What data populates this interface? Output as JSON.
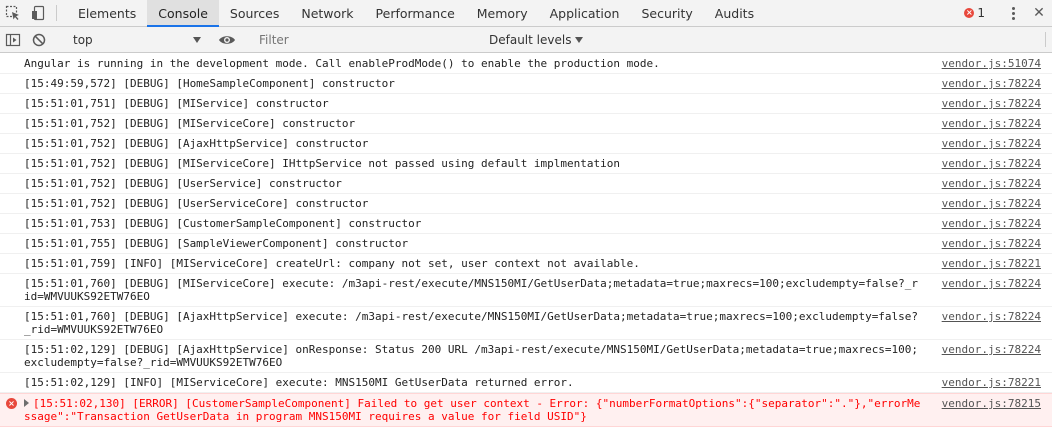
{
  "tabbar": {
    "tabs": [
      {
        "label": "Elements"
      },
      {
        "label": "Console"
      },
      {
        "label": "Sources"
      },
      {
        "label": "Network"
      },
      {
        "label": "Performance"
      },
      {
        "label": "Memory"
      },
      {
        "label": "Application"
      },
      {
        "label": "Security"
      },
      {
        "label": "Audits"
      }
    ],
    "selected_tab": "Console",
    "error_count": "1"
  },
  "toolbar": {
    "context": "top",
    "filter_placeholder": "Filter",
    "levels_label": "Default levels"
  },
  "messages": [
    {
      "text": "Angular is running in the development mode. Call enableProdMode() to enable the production mode.",
      "source": "vendor.js:51074",
      "level": "log"
    },
    {
      "text": "[15:49:59,572] [DEBUG] [HomeSampleComponent] constructor",
      "source": "vendor.js:78224",
      "level": "log"
    },
    {
      "text": "[15:51:01,751] [DEBUG] [MIService] constructor",
      "source": "vendor.js:78224",
      "level": "log"
    },
    {
      "text": "[15:51:01,752] [DEBUG] [MIServiceCore] constructor",
      "source": "vendor.js:78224",
      "level": "log"
    },
    {
      "text": "[15:51:01,752] [DEBUG] [AjaxHttpService] constructor",
      "source": "vendor.js:78224",
      "level": "log"
    },
    {
      "text": "[15:51:01,752] [DEBUG] [MIServiceCore] IHttpService not passed using default implmentation",
      "source": "vendor.js:78224",
      "level": "log"
    },
    {
      "text": "[15:51:01,752] [DEBUG] [UserService] constructor",
      "source": "vendor.js:78224",
      "level": "log"
    },
    {
      "text": "[15:51:01,752] [DEBUG] [UserServiceCore] constructor",
      "source": "vendor.js:78224",
      "level": "log"
    },
    {
      "text": "[15:51:01,753] [DEBUG] [CustomerSampleComponent] constructor",
      "source": "vendor.js:78224",
      "level": "log"
    },
    {
      "text": "[15:51:01,755] [DEBUG] [SampleViewerComponent] constructor",
      "source": "vendor.js:78224",
      "level": "log"
    },
    {
      "text": "[15:51:01,759] [INFO] [MIServiceCore] createUrl: company not set, user context not available.",
      "source": "vendor.js:78221",
      "level": "log"
    },
    {
      "text": "[15:51:01,760] [DEBUG] [MIServiceCore] execute: /m3api-rest/execute/MNS150MI/GetUserData;metadata=true;maxrecs=100;excludempty=false?_rid=WMVUUKS92ETW76EO",
      "source": "vendor.js:78224",
      "level": "log"
    },
    {
      "text": "[15:51:01,760] [DEBUG] [AjaxHttpService] execute: /m3api-rest/execute/MNS150MI/GetUserData;metadata=true;maxrecs=100;excludempty=false?_rid=WMVUUKS92ETW76EO",
      "source": "vendor.js:78224",
      "level": "log"
    },
    {
      "text": "[15:51:02,129] [DEBUG] [AjaxHttpService] onResponse: Status 200 URL /m3api-rest/execute/MNS150MI/GetUserData;metadata=true;maxrecs=100;excludempty=false?_rid=WMVUUKS92ETW76EO",
      "source": "vendor.js:78224",
      "level": "log"
    },
    {
      "text": "[15:51:02,129] [INFO] [MIServiceCore] execute: MNS150MI GetUserData returned error.",
      "source": "vendor.js:78221",
      "level": "log"
    },
    {
      "text": "[15:51:02,130] [ERROR] [CustomerSampleComponent] Failed to get user context - Error: {\"numberFormatOptions\":{\"separator\":\".\"},\"errorMessage\":\"Transaction GetUserData in program MNS150MI requires a value for field USID\"}",
      "source": "vendor.js:78215",
      "level": "error"
    }
  ]
}
